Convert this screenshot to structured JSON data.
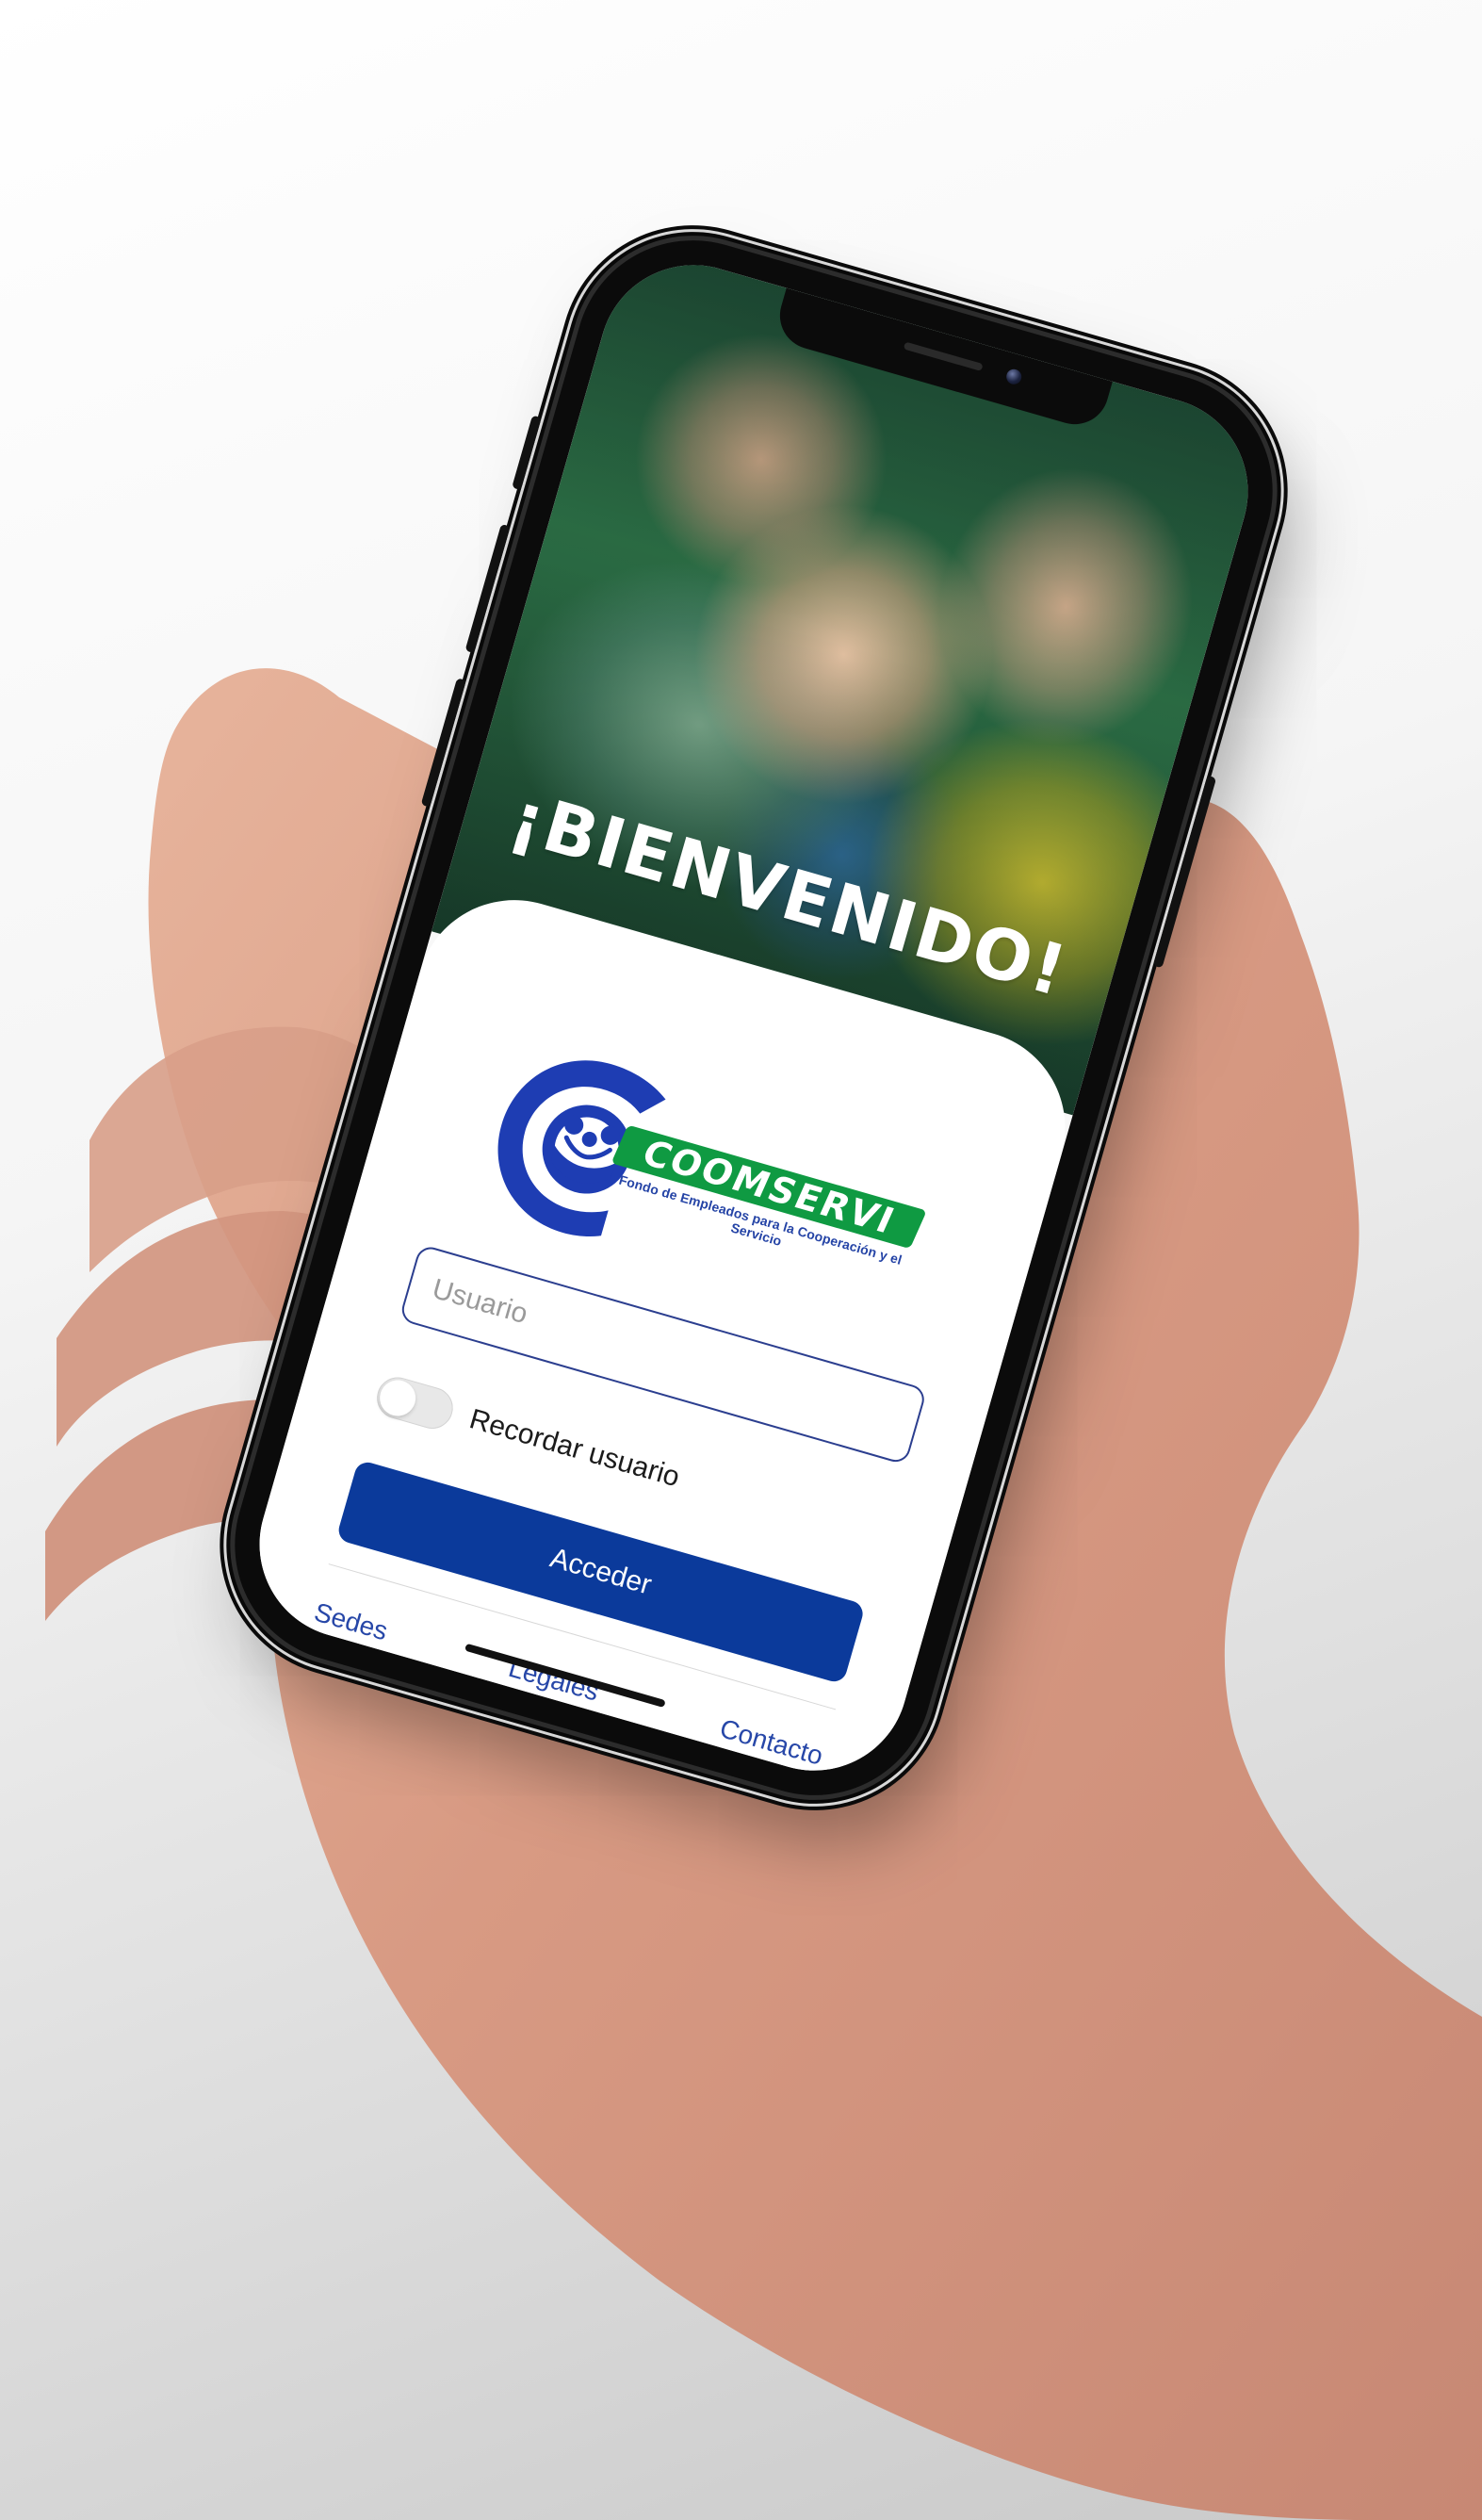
{
  "welcome_title": "¡BIENVENIDO!",
  "logo": {
    "brand_name": "COOMSERVI",
    "subtitle": "Fondo de Empleados para la Cooperación y el Servicio"
  },
  "login": {
    "username_placeholder": "Usuario",
    "remember_label": "Recordar usuario",
    "access_button": "Acceder",
    "remember_enabled": false
  },
  "footer": {
    "links": [
      "Sedes",
      "Legales",
      "Contacto"
    ]
  },
  "colors": {
    "primary_blue": "#0b3a9b",
    "link_blue": "#2747a8",
    "brand_green": "#0f9a42"
  }
}
